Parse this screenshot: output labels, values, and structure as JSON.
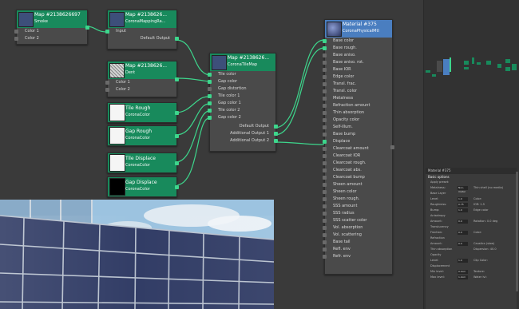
{
  "nodes": {
    "smoke": {
      "title": "Map #2138626697",
      "subtitle": "Smoke",
      "rows": [
        "Color 1",
        "Color 2"
      ]
    },
    "mapping": {
      "title": "Map #2138626...",
      "subtitle": "CoronaMappingRa...",
      "input": "Input",
      "output": "Default Output"
    },
    "dent": {
      "title": "Map #2138626...",
      "subtitle": "Dent",
      "rows": [
        "Color 1",
        "Color 2"
      ]
    },
    "tilemap": {
      "title": "Map #2138626...",
      "subtitle": "CoronaTileMap",
      "inputs": [
        "Tile color",
        "Gap color",
        "Gap distortion",
        "Tile color 1",
        "Gap color 1",
        "Tile color 2",
        "Gap color 2"
      ],
      "outputs": [
        "Default Output",
        "Additional Output 1",
        "Additional Output 2"
      ]
    },
    "tile_rough": {
      "title": "Tile Rough",
      "subtitle": "CoronaColor"
    },
    "gap_rough": {
      "title": "Gap Rough",
      "subtitle": "CoronaColor"
    },
    "tile_displace": {
      "title": "Tile Displace",
      "subtitle": "CoronaColor"
    },
    "gap_displace": {
      "title": "Gap Displace",
      "subtitle": "CoronaColor"
    },
    "material": {
      "title": "Material #375",
      "subtitle": "CoronaPhysicalMtl",
      "slots": [
        "Base color",
        "Base rough.",
        "Base aniso.",
        "Base aniso. rot.",
        "Base IOR",
        "Edge color",
        "Transl. frac.",
        "Transl. color",
        "Metalness",
        "Refraction amount",
        "Thin absorption",
        "Opacity color",
        "Self-illum.",
        "Base bump",
        "Displace",
        "Clearcoat amount",
        "Clearcoat IOR",
        "Clearcoat rough.",
        "Clearcoat abs.",
        "Clearcoat bump",
        "Sheen amount",
        "Sheen color",
        "Sheen rough.",
        "SSS amount",
        "SSS radius",
        "SSS scatter color",
        "Vol. absorption",
        "Vol. scattering",
        "Base tail",
        "Refl. env",
        "Refr. env"
      ]
    }
  },
  "panel": {
    "title": "Material #375",
    "section": "Basic options",
    "rows": [
      {
        "label": "Apply preset:",
        "value": ""
      },
      {
        "label": "Metalness:",
        "value": "Non-metal",
        "extra": "Thin shell (no media)"
      },
      {
        "label": "Base Layer",
        "value": ""
      },
      {
        "label": "Level:",
        "value": "1.0",
        "extra": "Color:"
      },
      {
        "label": "Roughness:",
        "value": "0.75",
        "extra": "IOR: 1.5"
      },
      {
        "label": "Bump:",
        "value": "1.0",
        "extra": "Edge color"
      },
      {
        "label": "Anisotropy",
        "value": ""
      },
      {
        "label": "Amount:",
        "value": "0.0",
        "extra": "Rotation: 0.0 deg"
      },
      {
        "label": "Translucency",
        "value": ""
      },
      {
        "label": "Fraction:",
        "value": "0.0",
        "extra": "Color:"
      },
      {
        "label": "Refraction",
        "value": ""
      },
      {
        "label": "Amount:",
        "value": "0.0",
        "extra": "Caustics (slow)"
      },
      {
        "label": "Thin absorption",
        "value": "",
        "extra": "Dispersion: 40.0"
      },
      {
        "label": "Opacity",
        "value": ""
      },
      {
        "label": "Level:",
        "value": "1.0",
        "extra": "Clip  Color:"
      },
      {
        "label": "Displacement",
        "value": ""
      },
      {
        "label": "Min level:",
        "value": "0.0cm",
        "extra": "Texture:"
      },
      {
        "label": "Max level:",
        "value": "1.0cm",
        "extra": "Water lvl:"
      }
    ]
  },
  "colors": {
    "node_header": "#188a5c",
    "material_header": "#4a7ec0",
    "wire": "#3dd68c",
    "canvas": "#3a3a3a"
  }
}
